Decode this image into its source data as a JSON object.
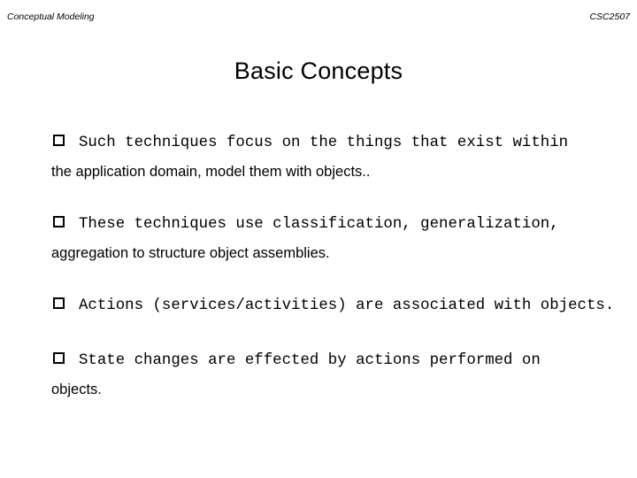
{
  "slide": {
    "header": {
      "left": "Conceptual Modeling",
      "right": "CSC2507"
    },
    "title": "Basic Concepts",
    "bullet_marker": "empty-square",
    "bullets": [
      {
        "marker": "□",
        "line1": "Such techniques focus on the things that exist within",
        "line2": "the application domain, model them with objects.."
      },
      {
        "marker": "□",
        "line1": "These techniques use classification, generalization,",
        "line2": "aggregation to structure object assemblies."
      },
      {
        "marker": "□",
        "line1": "Actions (services/activities) are associated with objects.",
        "line2": ""
      },
      {
        "marker": "□",
        "line1": "State changes are effected by actions performed on",
        "line2": "objects."
      }
    ]
  }
}
